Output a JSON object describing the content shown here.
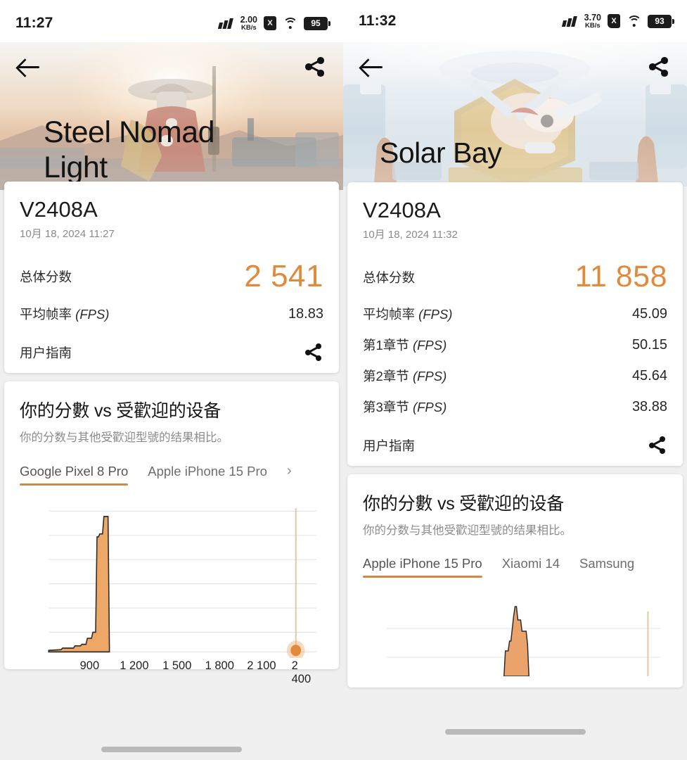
{
  "left": {
    "status": {
      "time": "11:27",
      "net_value": "2.00",
      "net_unit": "KB/s",
      "sim": "X",
      "battery": "95"
    },
    "hero": {
      "title": "Steel Nomad Light",
      "back_icon": "back-arrow-icon",
      "share_icon": "share-icon"
    },
    "score_card": {
      "device": "V2408A",
      "datetime": "10月 18, 2024 11:27",
      "rows": [
        {
          "label": "总体分数",
          "unit": "",
          "value": "2 541",
          "accent": true
        },
        {
          "label": "平均帧率",
          "unit": "(FPS)",
          "value": "18.83",
          "accent": false
        }
      ],
      "guide_label": "用户指南",
      "guide_share_icon": "share-icon"
    },
    "compare": {
      "title": "你的分數 vs 受歡迎的设备",
      "subtitle": "你的分数与其他受歡迎型號的结果相比。",
      "tabs": [
        {
          "label": "Google Pixel 8 Pro",
          "active": true
        },
        {
          "label": "Apple iPhone 15 Pro",
          "active": false
        },
        {
          "label": "›",
          "active": false,
          "more": true
        }
      ]
    },
    "chart_data": {
      "type": "area",
      "title": "",
      "xlabel": "",
      "ylabel": "",
      "xlim": [
        700,
        2560
      ],
      "ylim": [
        0,
        100
      ],
      "grid": true,
      "gridlines_y": [
        0,
        17,
        34,
        50,
        67,
        84,
        100
      ],
      "x": [
        700,
        760,
        800,
        840,
        880,
        900,
        920,
        940,
        960,
        980,
        1000,
        1020,
        1040,
        1100,
        1300,
        1600,
        1900,
        2200,
        2500
      ],
      "values": [
        1,
        2,
        3,
        4,
        6,
        10,
        12,
        60,
        60,
        82,
        82,
        96,
        0,
        0,
        0,
        0,
        0,
        0,
        0
      ],
      "marker": {
        "label": "2 541",
        "x": 2541,
        "y": 0,
        "color": "#e3893a"
      },
      "fill_color": "#efa86a",
      "line_color": "#2b2b2b",
      "marker_line_color": "#e7c49a",
      "xticks": [
        900,
        1200,
        1500,
        1800,
        2100,
        2400
      ],
      "xticklabels": [
        "900",
        "1 200",
        "1 500",
        "1 800",
        "2 100",
        "2 400"
      ]
    }
  },
  "right": {
    "status": {
      "time": "11:32",
      "net_value": "3.70",
      "net_unit": "KB/s",
      "sim": "X",
      "battery": "93"
    },
    "hero": {
      "title": "Solar Bay",
      "back_icon": "back-arrow-icon",
      "share_icon": "share-icon"
    },
    "score_card": {
      "device": "V2408A",
      "datetime": "10月 18, 2024 11:32",
      "rows": [
        {
          "label": "总体分数",
          "unit": "",
          "value": "11 858",
          "accent": true
        },
        {
          "label": "平均帧率",
          "unit": "(FPS)",
          "value": "45.09",
          "accent": false
        },
        {
          "label": "第1章节",
          "unit": "(FPS)",
          "value": "50.15",
          "accent": false
        },
        {
          "label": "第2章节",
          "unit": "(FPS)",
          "value": "45.64",
          "accent": false
        },
        {
          "label": "第3章节",
          "unit": "(FPS)",
          "value": "38.88",
          "accent": false
        }
      ],
      "guide_label": "用户指南",
      "guide_share_icon": "share-icon"
    },
    "compare": {
      "title": "你的分數 vs 受歡迎的设备",
      "subtitle": "你的分数与其他受歡迎型號的结果相比。",
      "tabs": [
        {
          "label": "Apple iPhone 15 Pro",
          "active": true
        },
        {
          "label": "Xiaomi 14",
          "active": false
        },
        {
          "label": "Samsung",
          "active": false
        }
      ]
    },
    "chart_data": {
      "type": "area",
      "title": "",
      "xlabel": "",
      "ylabel": "",
      "xlim": [
        0,
        100
      ],
      "ylim": [
        0,
        100
      ],
      "grid": true,
      "gridlines_y": [
        30,
        75
      ],
      "x": [
        0,
        40,
        44,
        46,
        48,
        50,
        51,
        52,
        53,
        54,
        56,
        60,
        100
      ],
      "values": [
        0,
        0,
        20,
        38,
        55,
        100,
        92,
        70,
        62,
        40,
        8,
        0,
        0
      ],
      "marker": {
        "label": "11 858",
        "x": 94,
        "y": 0,
        "color": "#e3893a"
      },
      "fill_color": "#eaa168",
      "line_color": "#2b2b2b",
      "marker_line_color": "#e7c49a",
      "xticks": [],
      "xticklabels": []
    }
  }
}
